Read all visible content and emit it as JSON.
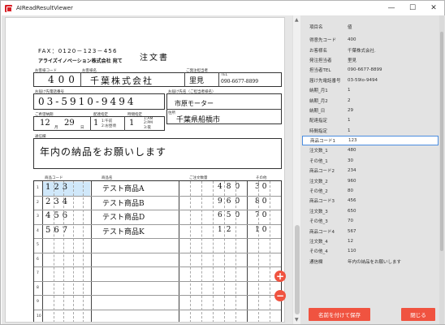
{
  "window": {
    "title": "AIReadResultViewer",
    "minimize": "—",
    "maximize": "☐",
    "close": "✕"
  },
  "doc": {
    "fax": "FAX：0120－123－456",
    "company_to": "アライズイノベーション株式会社 宛て",
    "title": "注文書",
    "label_customer_code": "お客様コード",
    "label_customer_name": "お客様名",
    "label_person": "ご発注担当者",
    "label_tel": "TEL",
    "customer_code": "400",
    "customer_name": "千葉株式会社",
    "person": "里見",
    "tel": "090-6677-8899",
    "label_dest_tel": "お届け先電話番号",
    "dest_tel": "03-5910-9494",
    "label_dest_name": "お届け先名（ご担当者様名）",
    "dest_name": "市原モーター",
    "label_address": "住所",
    "address": "千葉県船橋市",
    "label_deadline": "ご希望納期",
    "label_delivery": "配達指定",
    "label_time": "時間指定",
    "deadline_m": "12",
    "deadline_d": "29",
    "label_month": "月",
    "label_day": "日",
    "delivery": "1",
    "time": "1",
    "time_options": [
      "1:AM",
      "2:PM",
      "3:夜"
    ],
    "delivery_options": [
      "1:午前",
      "2:お昼頃"
    ],
    "label_note": "通信欄",
    "note": "年内の納品をお願いします",
    "label_product_code": "商品コード",
    "label_product_name": "商品名",
    "label_qty": "ご注文数量",
    "label_other": "その他",
    "items": [
      {
        "no": "1",
        "code": "123",
        "name": "テスト商品A",
        "qty": "480",
        "other": "30"
      },
      {
        "no": "2",
        "code": "234",
        "name": "テスト商品B",
        "qty": "960",
        "other": "80"
      },
      {
        "no": "3",
        "code": "456",
        "name": "テスト商品D",
        "qty": "650",
        "other": "70"
      },
      {
        "no": "4",
        "code": "567",
        "name": "テスト商品K",
        "qty": "12",
        "other": "10"
      },
      {
        "no": "5",
        "code": "",
        "name": "",
        "qty": "",
        "other": ""
      },
      {
        "no": "6",
        "code": "",
        "name": "",
        "qty": "",
        "other": ""
      },
      {
        "no": "7",
        "code": "",
        "name": "",
        "qty": "",
        "other": ""
      },
      {
        "no": "8",
        "code": "",
        "name": "",
        "qty": "",
        "other": ""
      },
      {
        "no": "9",
        "code": "",
        "name": "",
        "qty": "",
        "other": ""
      },
      {
        "no": "10",
        "code": "",
        "name": "",
        "qty": "",
        "other": ""
      }
    ]
  },
  "zoom": {
    "plus": "+",
    "minus": "−"
  },
  "results": {
    "header_key": "項目名",
    "header_value": "値",
    "rows": [
      {
        "k": "得意先コード",
        "v": "400"
      },
      {
        "k": "お客様名",
        "v": "千葉株式会社."
      },
      {
        "k": "発注担当者",
        "v": "里見"
      },
      {
        "k": "担当者TEL",
        "v": "090-6677-8899"
      },
      {
        "k": "届け先電話番号",
        "v": "03-59lo-9494"
      },
      {
        "k": "納期_月1",
        "v": "1"
      },
      {
        "k": "納期_月2",
        "v": "2"
      },
      {
        "k": "納期_日",
        "v": "29"
      },
      {
        "k": "配達指定",
        "v": "1"
      },
      {
        "k": "時間指定",
        "v": "1"
      },
      {
        "k": "商品コード1",
        "v": "123"
      },
      {
        "k": "注文数_1",
        "v": "480"
      },
      {
        "k": "その他_1",
        "v": "30"
      },
      {
        "k": "商品コード2",
        "v": "234"
      },
      {
        "k": "注文数_2",
        "v": "960"
      },
      {
        "k": "その他_2",
        "v": "80"
      },
      {
        "k": "商品コード3",
        "v": "456"
      },
      {
        "k": "注文数_3",
        "v": "650"
      },
      {
        "k": "その他_3",
        "v": "70"
      },
      {
        "k": "商品コード4",
        "v": "567"
      },
      {
        "k": "注文数_4",
        "v": "12"
      },
      {
        "k": "その他_4",
        "v": "110"
      },
      {
        "k": "通信欄",
        "v": "年内の納品をお願いします"
      }
    ],
    "selected_index": 10
  },
  "buttons": {
    "save_as": "名前を付けて保存",
    "close": "閉じる"
  },
  "colors": {
    "accent": "#f05340",
    "select_border": "#4a8de0"
  }
}
